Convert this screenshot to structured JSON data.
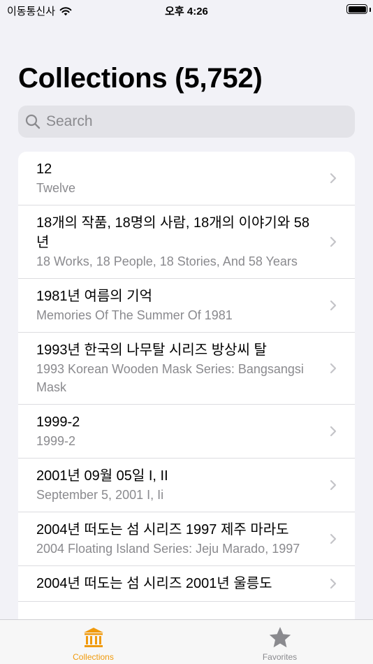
{
  "status_bar": {
    "carrier": "이동통신사",
    "time": "오후 4:26"
  },
  "page_title": "Collections (5,752)",
  "search": {
    "placeholder": "Search"
  },
  "collections": [
    {
      "title": "12",
      "subtitle": "Twelve"
    },
    {
      "title": "18개의 작품, 18명의 사람, 18개의 이야기와 58년",
      "subtitle": "18 Works, 18 People, 18 Stories, And 58 Years"
    },
    {
      "title": "1981년 여름의 기억",
      "subtitle": "Memories Of The Summer Of 1981"
    },
    {
      "title": "1993년 한국의 나무탈 시리즈 방상씨 탈",
      "subtitle": "1993 Korean Wooden Mask Series: Bangsangsi Mask"
    },
    {
      "title": "1999-2",
      "subtitle": "1999-2"
    },
    {
      "title": "2001년 09월 05일 I, II",
      "subtitle": "September 5, 2001 I, Ii"
    },
    {
      "title": "2004년 떠도는 섬 시리즈 1997 제주 마라도",
      "subtitle": "2004 Floating Island Series: Jeju Marado, 1997"
    },
    {
      "title": "2004년 떠도는 섬 시리즈 2001년 울릉도",
      "subtitle": ""
    }
  ],
  "tabs": [
    {
      "label": "Collections",
      "icon": "museum-icon",
      "active": true
    },
    {
      "label": "Favorites",
      "icon": "star-icon",
      "active": false
    }
  ],
  "colors": {
    "accent": "#f09a0c",
    "inactive": "#8a8a8e",
    "background": "#f2f2f7"
  }
}
